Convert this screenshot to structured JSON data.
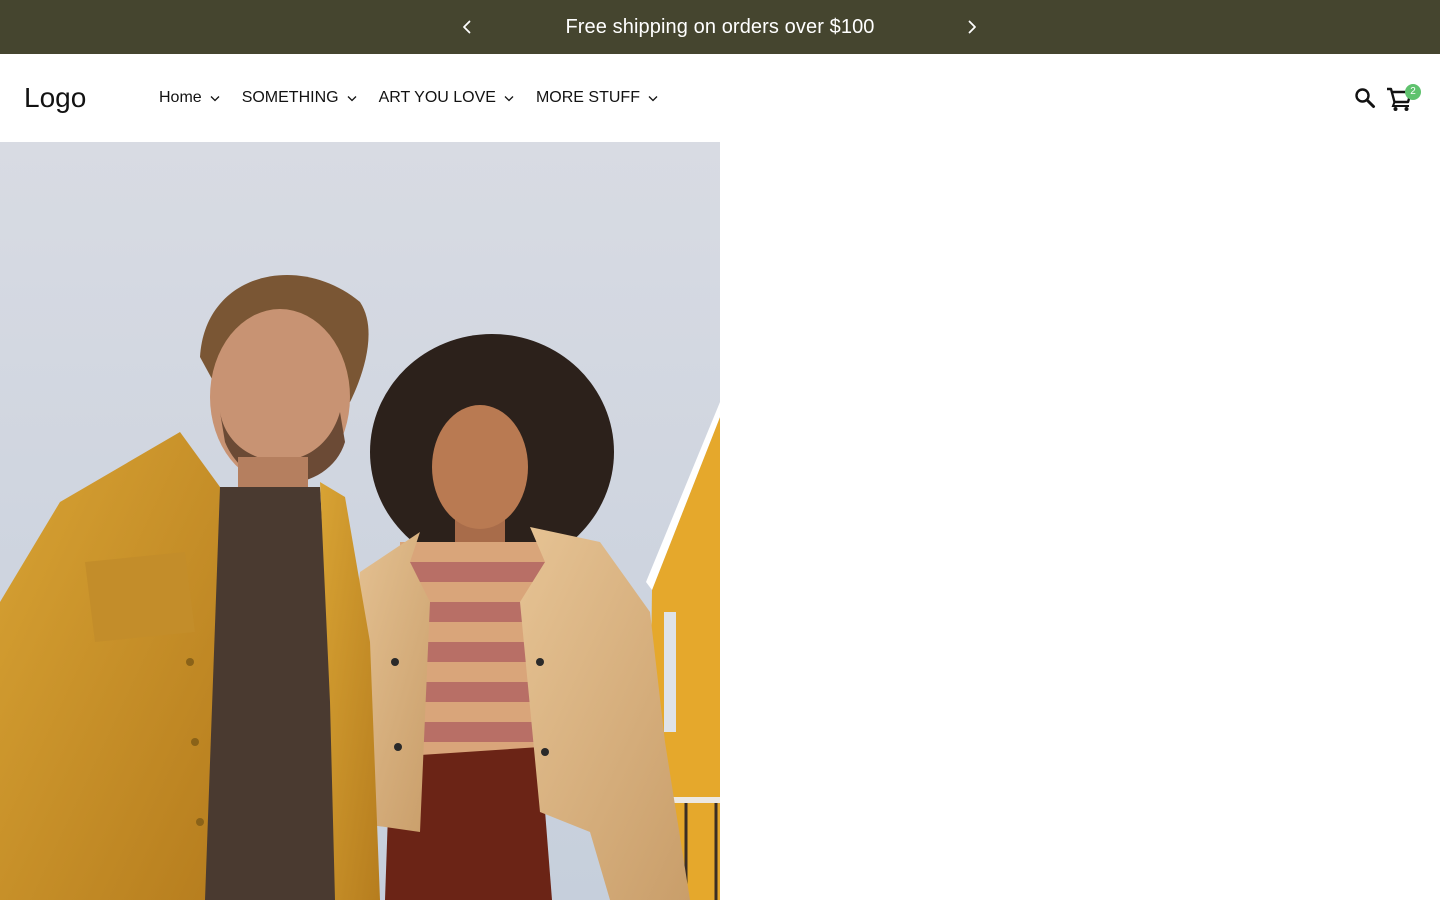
{
  "announcement": {
    "text": "Free shipping on orders over $100",
    "background": "#45452f"
  },
  "header": {
    "logo": "Logo",
    "nav": [
      {
        "label": "Home"
      },
      {
        "label": "SOMETHING"
      },
      {
        "label": "ART YOU LOVE"
      },
      {
        "label": "MORE STUFF"
      }
    ],
    "icons": {
      "search": "search-icon",
      "cart": "cart-icon"
    },
    "cart_count": "2",
    "badge_color": "#5fc26e"
  }
}
